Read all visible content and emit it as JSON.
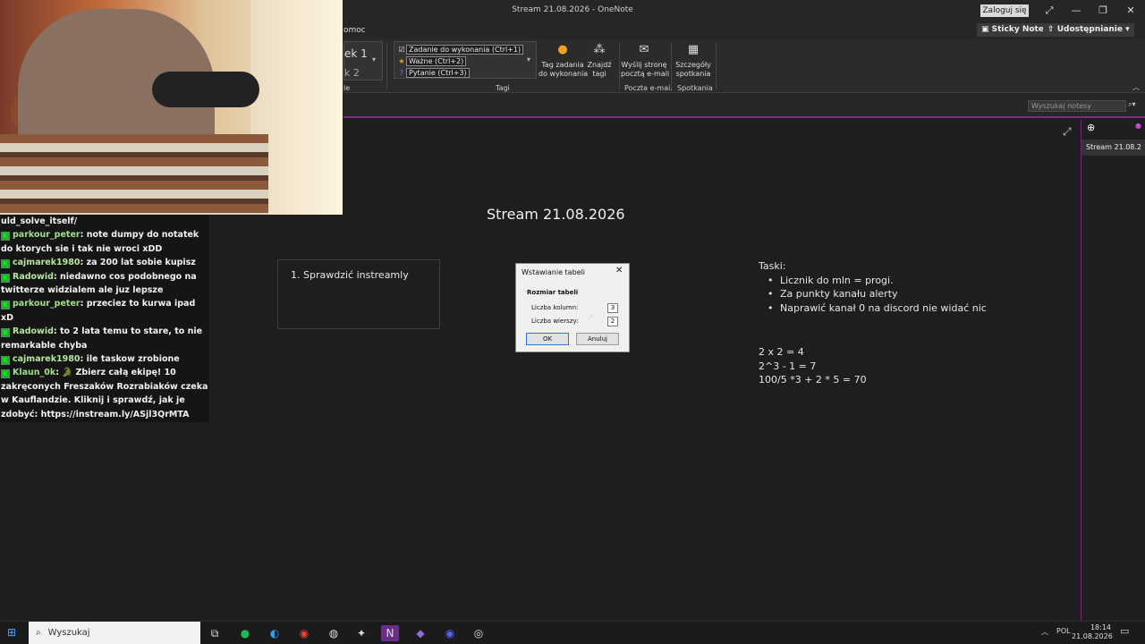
{
  "window": {
    "title": "Stream 21.08.2026   -   OneNote",
    "signin": "Zaloguj się",
    "minimize_icon": "—",
    "maximize_icon": "❐",
    "close_icon": "✕",
    "fullscreen_icon": "⤢"
  },
  "tabs": {
    "help_partial": "omoc",
    "sticky_notes": "Sticky Notes",
    "share": "Udostępnianie"
  },
  "ribbon": {
    "styles": {
      "style1": "ek 1",
      "style2": "k 2",
      "group_label_partial": "le"
    },
    "tags": {
      "items": [
        {
          "mark": "☑",
          "label": "Zadanie do wykonania (Ctrl+1)"
        },
        {
          "mark": "★",
          "label": "Ważne (Ctrl+2)"
        },
        {
          "mark": "?",
          "label": "Pytanie (Ctrl+3)"
        }
      ],
      "todo_tag": "Tag zadania\ndo wykonania",
      "find_tags": "Znajdź\ntagi",
      "group_label": "Tagi"
    },
    "email": {
      "button": "Wyślij stronę\npocztą e-mail",
      "group_label": "Poczta e-mail"
    },
    "meetings": {
      "button": "Szczegóły\nspotkania",
      "group_label": "Spotkania"
    }
  },
  "search": {
    "placeholder": "Wyszukaj notesy"
  },
  "page": {
    "title": "Stream 21.08.2026",
    "container1_item": "1.   Sprawdzić instreamly",
    "tasks_heading": "Taski:",
    "tasks": [
      "Licznik do mln = progi.",
      "Za punkty kanału alerty",
      "Naprawić kanał 0 na discord nie widać nic"
    ],
    "math": [
      "2 x 2 = 4",
      "2^3 - 1 = 7",
      "100/5 *3 + 2 * 5 = 70"
    ]
  },
  "page_list": {
    "add_icon": "⊕",
    "items": [
      "Stream 21.08.2"
    ]
  },
  "dialog": {
    "title": "Wstawianie tabeli",
    "group": "Rozmiar tabeli",
    "columns_label": "Liczba kolumn:",
    "columns_value": "3",
    "rows_label": "Liczba wierszy:",
    "rows_value": "2",
    "ok": "OK",
    "cancel": "Anuluj"
  },
  "chat": {
    "lines": [
      {
        "user": "",
        "text": "uld_solve_itself/"
      },
      {
        "user": "parkour_peter",
        "text": "note dumpy do notatek do ktorych sie i tak nie wroci xDD"
      },
      {
        "user": "cajmarek1980",
        "text": "za 200 lat sobie kupisz"
      },
      {
        "user": "Radowid",
        "text": "niedawno cos podobnego na twitterze widzialem ale juz lepsze"
      },
      {
        "user": "parkour_peter",
        "text": "przeciez to kurwa ipad xD"
      },
      {
        "user": "Radowid",
        "text": "to 2 lata temu to stare, to nie remarkable chyba"
      },
      {
        "user": "cajmarek1980",
        "text": "ile taskow zrobione"
      },
      {
        "user": "Klaun_0k",
        "text": "🐊 Zbierz całą ekipę! 10 zakręconych Freszaków Rozrabiaków czeka w Kauflandzie. Kliknij i sprawdź, jak je zdobyć: https://instream.ly/ASjl3QrMTA"
      }
    ]
  },
  "taskbar": {
    "search_placeholder": "Wyszukaj",
    "lang": "POL",
    "time": "18:14",
    "date": "21.08.2026"
  }
}
